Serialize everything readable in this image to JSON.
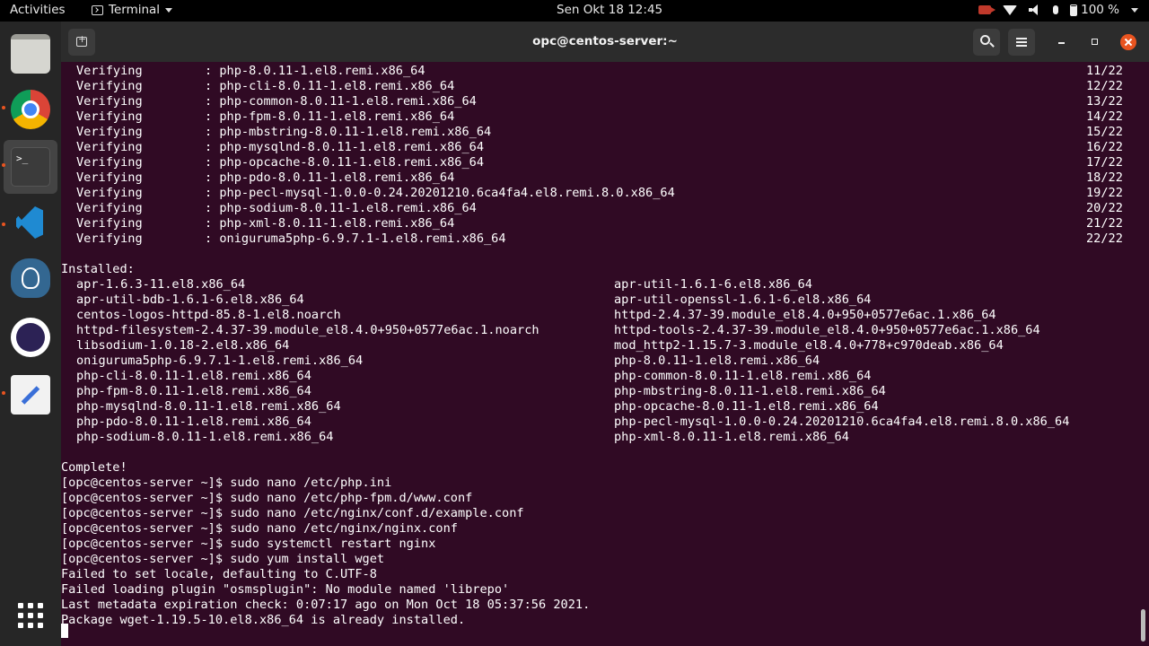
{
  "topbar": {
    "activities": "Activities",
    "app_name": "Terminal",
    "clock": "Sen Okt 18  12:45",
    "battery": "100 %"
  },
  "dock": {
    "items": [
      "Files",
      "Google Chrome",
      "Terminal",
      "Visual Studio Code",
      "pgAdmin",
      "Eclipse",
      "Text Editor",
      "Show Applications"
    ]
  },
  "titlebar": {
    "title": "opc@centos-server:~"
  },
  "terminal": {
    "verifying": [
      {
        "label": "Verifying",
        "pkg": ": php-8.0.11-1.el8.remi.x86_64",
        "count": "11/22"
      },
      {
        "label": "Verifying",
        "pkg": ": php-cli-8.0.11-1.el8.remi.x86_64",
        "count": "12/22"
      },
      {
        "label": "Verifying",
        "pkg": ": php-common-8.0.11-1.el8.remi.x86_64",
        "count": "13/22"
      },
      {
        "label": "Verifying",
        "pkg": ": php-fpm-8.0.11-1.el8.remi.x86_64",
        "count": "14/22"
      },
      {
        "label": "Verifying",
        "pkg": ": php-mbstring-8.0.11-1.el8.remi.x86_64",
        "count": "15/22"
      },
      {
        "label": "Verifying",
        "pkg": ": php-mysqlnd-8.0.11-1.el8.remi.x86_64",
        "count": "16/22"
      },
      {
        "label": "Verifying",
        "pkg": ": php-opcache-8.0.11-1.el8.remi.x86_64",
        "count": "17/22"
      },
      {
        "label": "Verifying",
        "pkg": ": php-pdo-8.0.11-1.el8.remi.x86_64",
        "count": "18/22"
      },
      {
        "label": "Verifying",
        "pkg": ": php-pecl-mysql-1.0.0-0.24.20201210.6ca4fa4.el8.remi.8.0.x86_64",
        "count": "19/22"
      },
      {
        "label": "Verifying",
        "pkg": ": php-sodium-8.0.11-1.el8.remi.x86_64",
        "count": "20/22"
      },
      {
        "label": "Verifying",
        "pkg": ": php-xml-8.0.11-1.el8.remi.x86_64",
        "count": "21/22"
      },
      {
        "label": "Verifying",
        "pkg": ": oniguruma5php-6.9.7.1-1.el8.remi.x86_64",
        "count": "22/22"
      }
    ],
    "installed_header": "Installed:",
    "installed": [
      [
        "apr-1.6.3-11.el8.x86_64",
        "apr-util-1.6.1-6.el8.x86_64"
      ],
      [
        "apr-util-bdb-1.6.1-6.el8.x86_64",
        "apr-util-openssl-1.6.1-6.el8.x86_64"
      ],
      [
        "centos-logos-httpd-85.8-1.el8.noarch",
        "httpd-2.4.37-39.module_el8.4.0+950+0577e6ac.1.x86_64"
      ],
      [
        "httpd-filesystem-2.4.37-39.module_el8.4.0+950+0577e6ac.1.noarch",
        "httpd-tools-2.4.37-39.module_el8.4.0+950+0577e6ac.1.x86_64"
      ],
      [
        "libsodium-1.0.18-2.el8.x86_64",
        "mod_http2-1.15.7-3.module_el8.4.0+778+c970deab.x86_64"
      ],
      [
        "oniguruma5php-6.9.7.1-1.el8.remi.x86_64",
        "php-8.0.11-1.el8.remi.x86_64"
      ],
      [
        "php-cli-8.0.11-1.el8.remi.x86_64",
        "php-common-8.0.11-1.el8.remi.x86_64"
      ],
      [
        "php-fpm-8.0.11-1.el8.remi.x86_64",
        "php-mbstring-8.0.11-1.el8.remi.x86_64"
      ],
      [
        "php-mysqlnd-8.0.11-1.el8.remi.x86_64",
        "php-opcache-8.0.11-1.el8.remi.x86_64"
      ],
      [
        "php-pdo-8.0.11-1.el8.remi.x86_64",
        "php-pecl-mysql-1.0.0-0.24.20201210.6ca4fa4.el8.remi.8.0.x86_64"
      ],
      [
        "php-sodium-8.0.11-1.el8.remi.x86_64",
        "php-xml-8.0.11-1.el8.remi.x86_64"
      ]
    ],
    "tail_lines": [
      "Complete!",
      "[opc@centos-server ~]$ sudo nano /etc/php.ini",
      "[opc@centos-server ~]$ sudo nano /etc/php-fpm.d/www.conf",
      "[opc@centos-server ~]$ sudo nano /etc/nginx/conf.d/example.conf",
      "[opc@centos-server ~]$ sudo nano /etc/nginx/nginx.conf",
      "[opc@centos-server ~]$ sudo systemctl restart nginx",
      "[opc@centos-server ~]$ sudo yum install wget",
      "Failed to set locale, defaulting to C.UTF-8",
      "Failed loading plugin \"osmsplugin\": No module named 'librepo'",
      "Last metadata expiration check: 0:07:17 ago on Mon Oct 18 05:37:56 2021.",
      "Package wget-1.19.5-10.el8.x86_64 is already installed."
    ]
  }
}
